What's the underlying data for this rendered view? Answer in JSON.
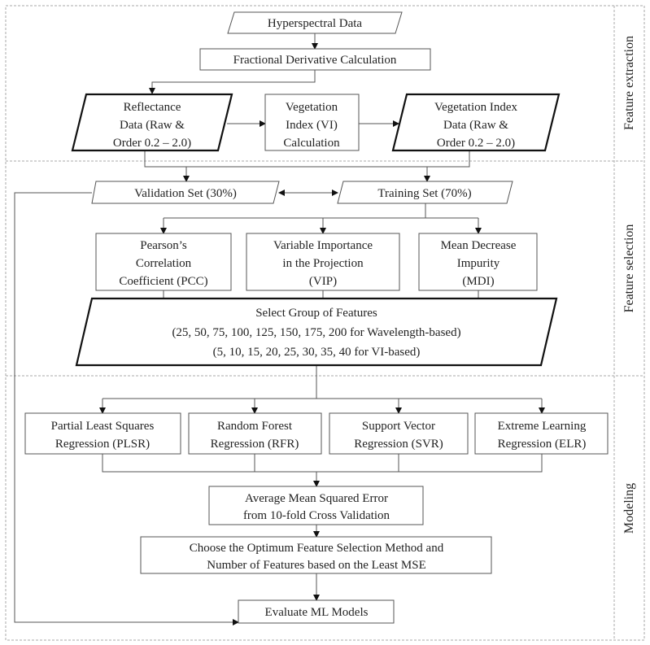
{
  "sections": [
    "Feature extraction",
    "Feature selection",
    "Modeling"
  ],
  "nodes": {
    "hyperspectral": [
      "Hyperspectral Data"
    ],
    "fractional": [
      "Fractional Derivative Calculation"
    ],
    "reflectance": [
      "Reflectance",
      "Data (Raw &",
      "Order 0.2 – 2.0)"
    ],
    "vi_calc": [
      "Vegetation",
      "Index (VI)",
      "Calculation"
    ],
    "vi_data": [
      "Vegetation Index",
      "Data (Raw &",
      "Order 0.2 – 2.0)"
    ],
    "validation": [
      "Validation Set (30%)"
    ],
    "training": [
      "Training Set (70%)"
    ],
    "pcc": [
      "Pearson’s",
      "Correlation",
      "Coefficient (PCC)"
    ],
    "vip": [
      "Variable Importance",
      "in the Projection",
      "(VIP)"
    ],
    "mdi": [
      "Mean Decrease",
      "Impurity",
      "(MDI)"
    ],
    "select": [
      "Select Group of Features",
      "(25, 50, 75, 100, 125, 150, 175, 200 for Wavelength-based)",
      "(5, 10, 15, 20, 25, 30, 35, 40 for VI-based)"
    ],
    "plsr": [
      "Partial Least Squares",
      "Regression (PLSR)"
    ],
    "rfr": [
      "Random Forest",
      "Regression (RFR)"
    ],
    "svr": [
      "Support Vector",
      "Regression (SVR)"
    ],
    "elr": [
      "Extreme Learning",
      "Regression (ELR)"
    ],
    "mse": [
      "Average Mean Squared Error",
      "from 10-fold Cross Validation"
    ],
    "choose": [
      "Choose the Optimum Feature Selection Method and",
      "Number of Features based on the Least MSE"
    ],
    "evaluate": [
      "Evaluate ML Models"
    ]
  }
}
